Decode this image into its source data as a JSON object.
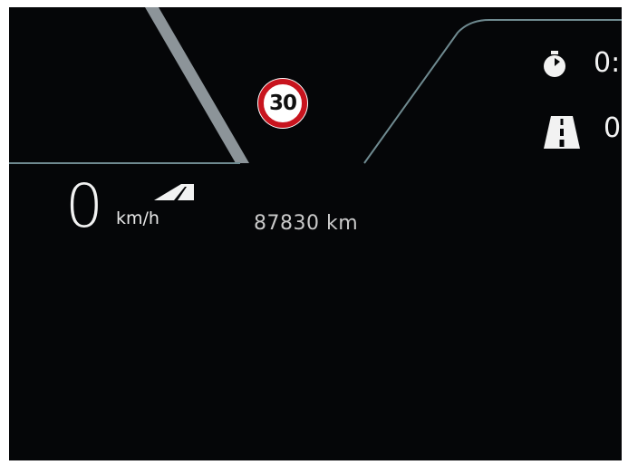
{
  "speed_limit_sign": {
    "value": "30",
    "ring_color": "#c8141e",
    "icon": "speed-limit-sign-icon"
  },
  "speedometer": {
    "value": "0",
    "unit": "km/h",
    "icon": "road-wedge-icon"
  },
  "odometer": {
    "value": "87830 km"
  },
  "trip_panel": {
    "timer_icon": "stopwatch-icon",
    "timer_value": "0:",
    "distance_icon": "road-icon",
    "distance_value": "0"
  },
  "colors": {
    "background": "#050608",
    "panel_outline": "#6f8a90",
    "road_stripe": "#8c9499",
    "text_primary": "#f2f2f2",
    "text_secondary": "#c9c9c9"
  }
}
